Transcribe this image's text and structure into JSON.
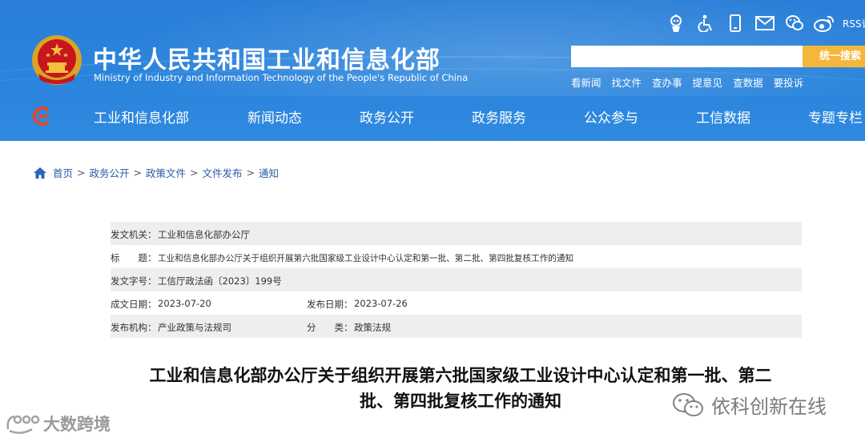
{
  "header": {
    "title": "中华人民共和国工业和信息化部",
    "subtitle": "Ministry of Industry and Information Technology of the People's Republic of China",
    "top_icons": [
      "robot-icon",
      "accessibility-icon",
      "mobile-icon",
      "mail-icon",
      "wechat-icon",
      "weibo-icon"
    ],
    "rss_label": "RSS订阅",
    "search": {
      "value": "",
      "button_label": "统一搜索"
    },
    "quick_links": [
      "看新闻",
      "找文件",
      "查办事",
      "提意见",
      "查数据",
      "要投诉"
    ],
    "nav": [
      "工业和信息化部",
      "新闻动态",
      "政务公开",
      "政务服务",
      "公众参与",
      "工信数据",
      "专题专栏"
    ],
    "colors": {
      "header_blue": "#2b84dc",
      "search_button": "#f5b73a"
    }
  },
  "breadcrumb": [
    "首页",
    "政务公开",
    "政策文件",
    "文件发布",
    "通知"
  ],
  "meta": {
    "issuer_label": "发文机关：",
    "issuer": "工业和信息化部办公厅",
    "title_label": "标　　题：",
    "title": "工业和信息化部办公厅关于组织开展第六批国家级工业设计中心认定和第一批、第二批、第四批复核工作的通知",
    "doc_no_label": "发文字号：",
    "doc_no": "工信厅政法函〔2023〕199号",
    "date_written_label": "成文日期：",
    "date_written": "2023-07-20",
    "date_published_label": "发布日期：",
    "date_published": "2023-07-26",
    "publisher_label": "发布机构：",
    "publisher": "产业政策与法规司",
    "category_label": "分　　类：",
    "category": "政策法规"
  },
  "article": {
    "title_line1": "工业和信息化部办公厅关于组织开展第六批国家级工业设计中心认定和第一批、第二",
    "title_line2": "批、第四批复核工作的通知"
  },
  "watermarks": {
    "left": "大数跨境",
    "right": "依科创新在线"
  }
}
